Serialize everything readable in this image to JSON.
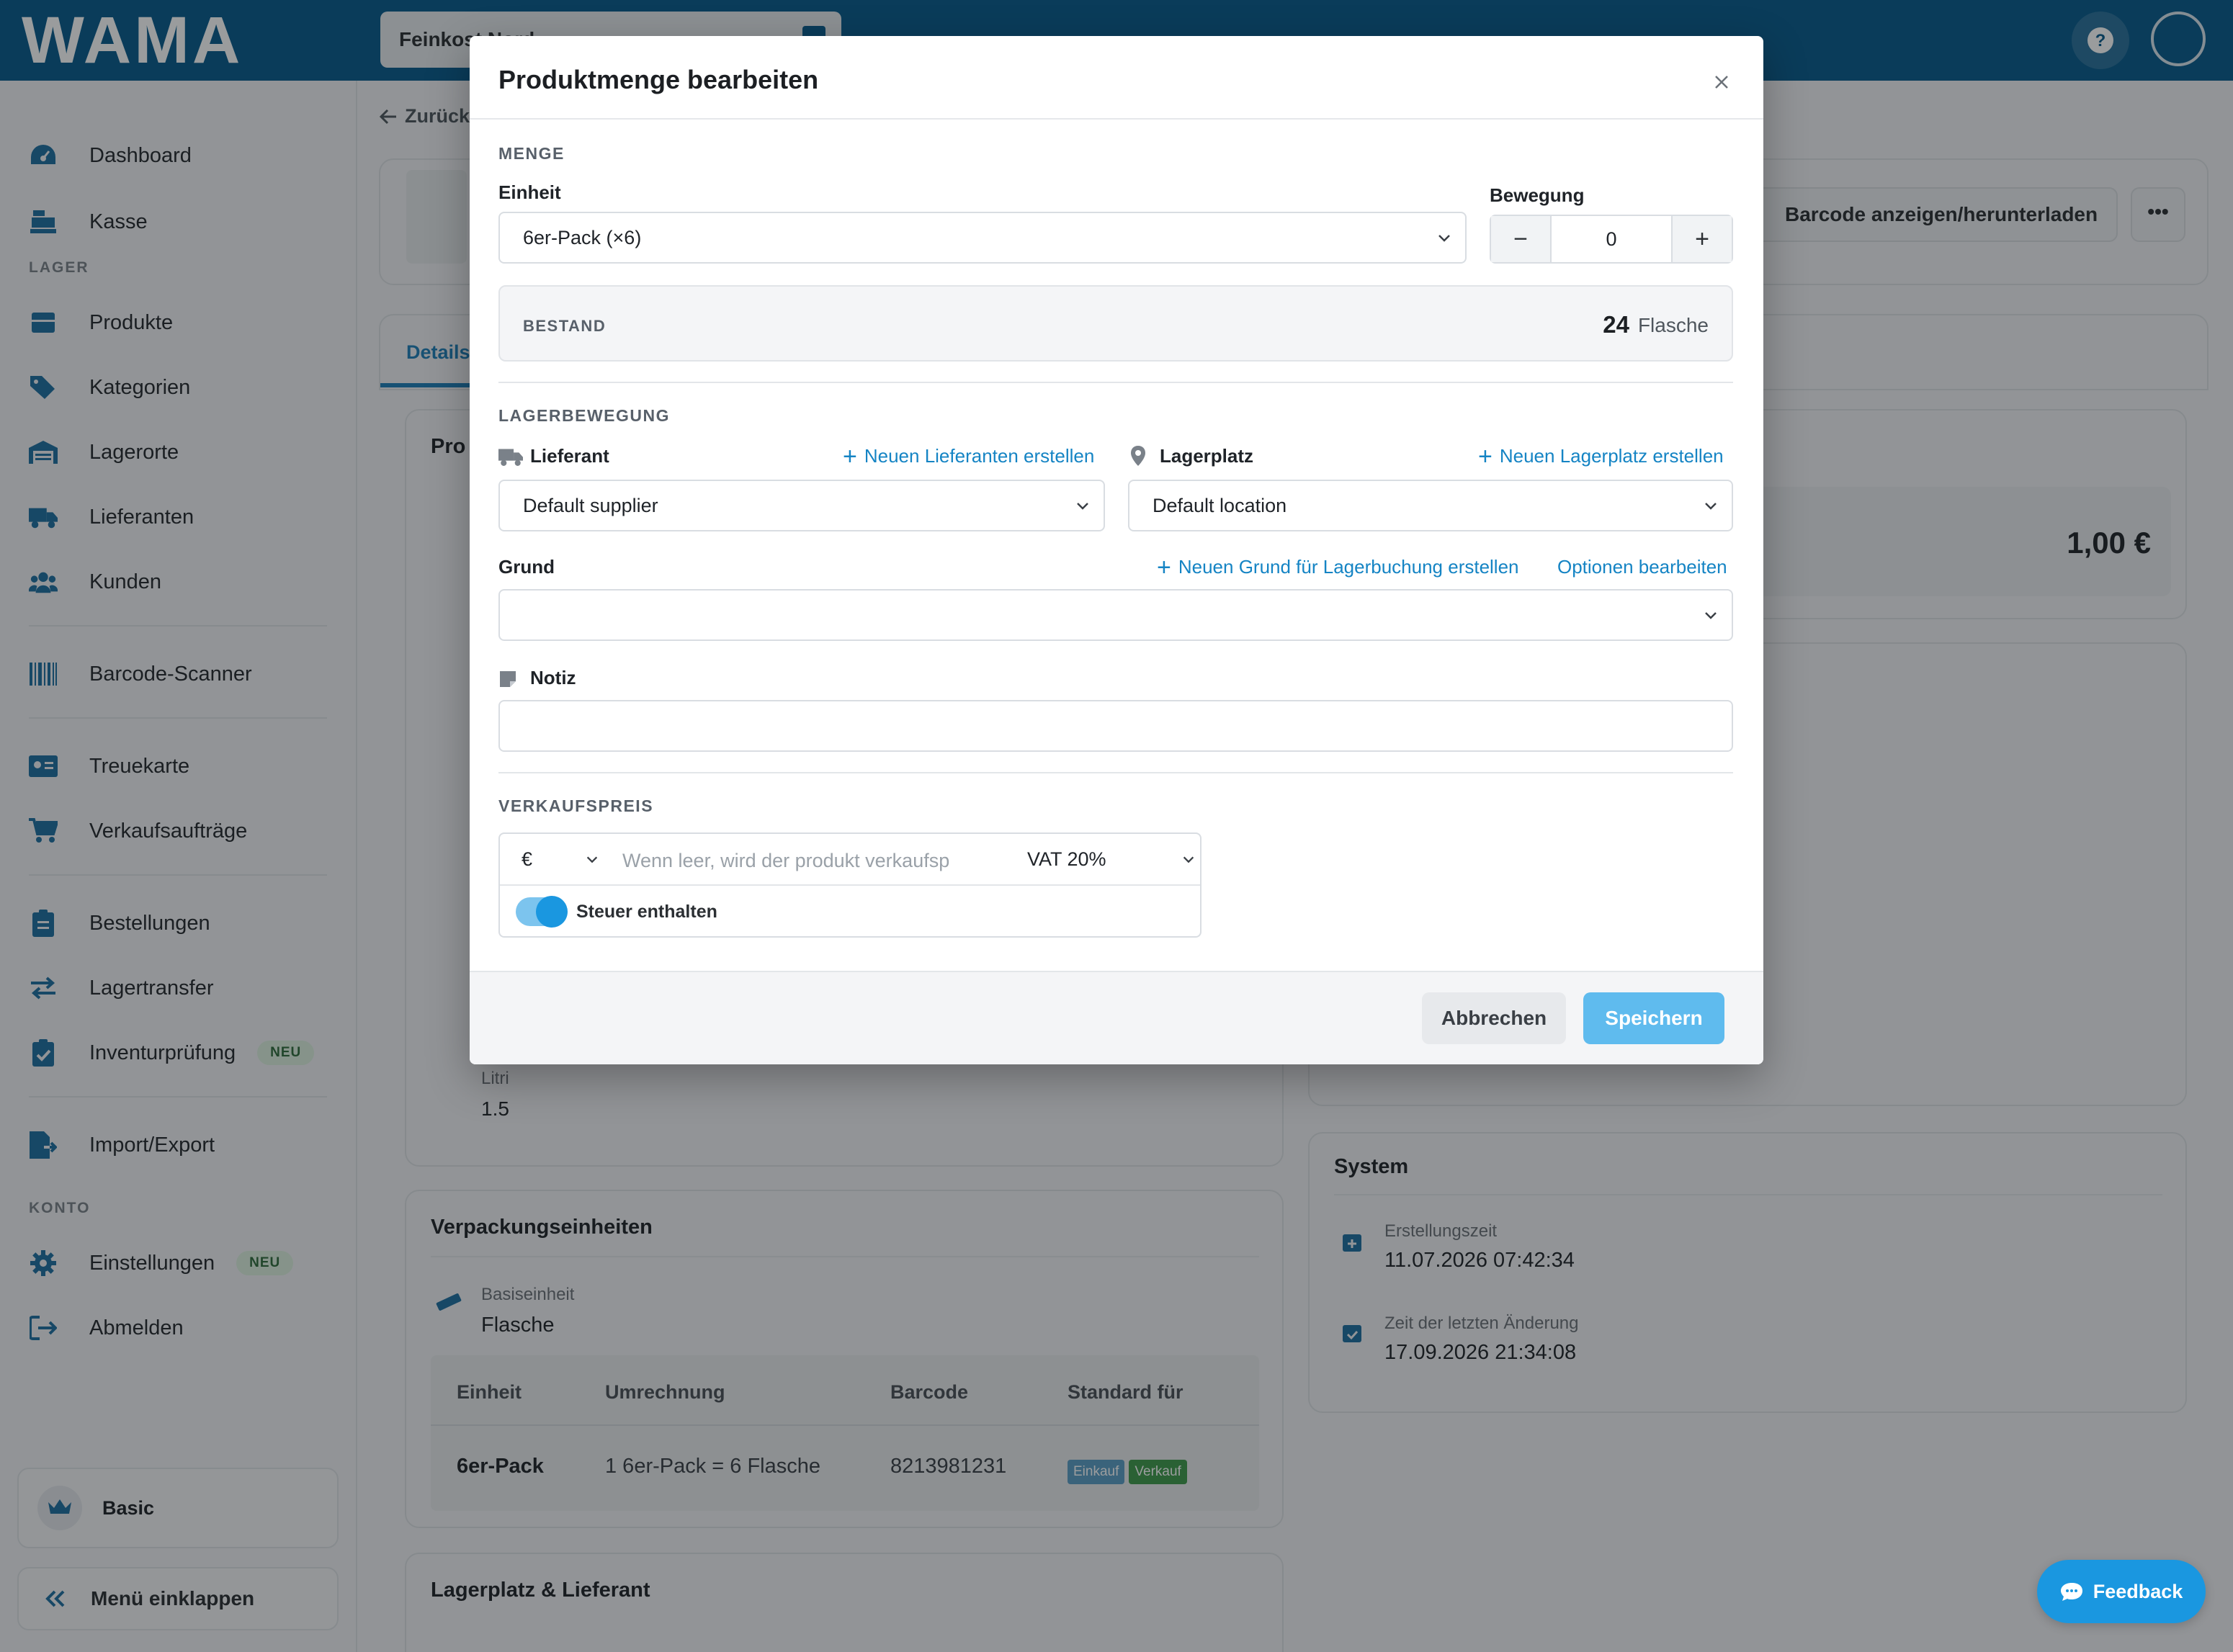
{
  "app": {
    "logo_text": "WAMA",
    "store_selector": "Feinkost Nord"
  },
  "sidebar": {
    "items_top": [
      {
        "label": "Dashboard",
        "icon": "dashboard-gauge-icon"
      },
      {
        "label": "Kasse",
        "icon": "cash-register-icon"
      }
    ],
    "section_lager": "LAGER",
    "items_lager": [
      {
        "label": "Produkte",
        "icon": "box-icon"
      },
      {
        "label": "Kategorien",
        "icon": "tags-icon"
      },
      {
        "label": "Lagerorte",
        "icon": "warehouse-icon"
      },
      {
        "label": "Lieferanten",
        "icon": "truck-icon"
      },
      {
        "label": "Kunden",
        "icon": "users-icon"
      }
    ],
    "barcode_scanner": "Barcode-Scanner",
    "treuekarte": "Treuekarte",
    "verkaufsauftraege": "Verkaufsaufträge",
    "bestellungen": "Bestellungen",
    "lagertransfer": "Lagertransfer",
    "inventurpruefung": "Inventurprüfung",
    "badge_neu": "NEU",
    "import_export": "Import/Export",
    "section_konto": "KONTO",
    "einstellungen": "Einstellungen",
    "abmelden": "Abmelden",
    "plan": "Basic",
    "collapse": "Menü einklappen"
  },
  "page": {
    "back": "Zurück",
    "barcode_button": "Barcode anzeigen/herunterladen",
    "more_button": "•••",
    "tab_details": "Details",
    "product_card_title": "Pro",
    "price_value": "1,00 €",
    "litri_label": "Litri",
    "litri_value": "1.5",
    "system": {
      "title": "System",
      "created_label": "Erstellungszeit",
      "created_value": "11.07.2026 07:42:34",
      "updated_label": "Zeit der letzten Änderung",
      "updated_value": "17.09.2026 21:34:08"
    },
    "packaging": {
      "title": "Verpackungseinheiten",
      "base_label": "Basiseinheit",
      "base_value": "Flasche",
      "headers": [
        "Einheit",
        "Umrechnung",
        "Barcode",
        "Standard für"
      ],
      "rows": [
        {
          "unit": "6er-Pack",
          "conversion": "1 6er-Pack = 6 Flasche",
          "barcode": "8213981231",
          "chips": [
            "Einkauf",
            "Verkauf"
          ]
        }
      ]
    },
    "lager_title": "Lagerplatz & Lieferant",
    "feedback": "Feedback"
  },
  "modal": {
    "title": "Produktmenge bearbeiten",
    "section_menge": "MENGE",
    "einheit_label": "Einheit",
    "einheit_value": "6er-Pack (×6)",
    "bewegung_label": "Bewegung",
    "bewegung_value": "0",
    "minus": "−",
    "plus": "+",
    "bestand_label": "BESTAND",
    "bestand_value": "24",
    "bestand_unit": "Flasche",
    "section_lagerbewegung": "LAGERBEWEGUNG",
    "lieferant_label": "Lieferant",
    "new_lieferant": "Neuen Lieferanten erstellen",
    "lieferant_value": "Default supplier",
    "lagerplatz_label": "Lagerplatz",
    "new_lagerplatz": "Neuen Lagerplatz erstellen",
    "lagerplatz_value": "Default location",
    "grund_label": "Grund",
    "new_grund": "Neuen Grund für Lagerbuchung erstellen",
    "edit_options": "Optionen bearbeiten",
    "grund_value": "",
    "notiz_label": "Notiz",
    "notiz_value": "",
    "section_verkaufspreis": "VERKAUFSPREIS",
    "currency": "€",
    "price_placeholder": "Wenn leer, wird der produkt verkaufsp",
    "vat": "VAT 20%",
    "tax_included_label": "Steuer enthalten",
    "tax_included": true,
    "cancel": "Abbrechen",
    "save": "Speichern"
  },
  "colors": {
    "topbar": "#075a8c",
    "accent": "#1a97e0",
    "link": "#1584c4",
    "save_button": "#5fbbee",
    "chip_einkauf": "#5b9dc4",
    "chip_verkauf": "#3e9a4a"
  }
}
